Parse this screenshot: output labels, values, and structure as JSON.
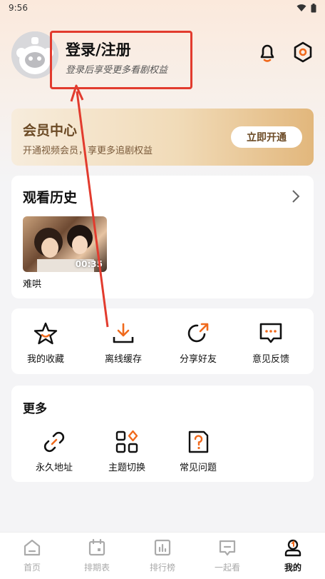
{
  "status_bar": {
    "time": "9:56"
  },
  "profile": {
    "login_title": "登录/注册",
    "login_subtitle": "登录后享受更多看剧权益"
  },
  "vip": {
    "title": "会员中心",
    "subtitle": "开通视频会员，享更多追剧权益",
    "button": "立即开通"
  },
  "history": {
    "title": "观看历史",
    "items": [
      {
        "name": "难哄",
        "duration": "00:35"
      }
    ]
  },
  "tools": [
    {
      "label": "我的收藏",
      "icon": "star-icon"
    },
    {
      "label": "离线缓存",
      "icon": "download-icon"
    },
    {
      "label": "分享好友",
      "icon": "share-icon"
    },
    {
      "label": "意见反馈",
      "icon": "feedback-icon"
    }
  ],
  "more": {
    "title": "更多",
    "items": [
      {
        "label": "永久地址",
        "icon": "link-icon"
      },
      {
        "label": "主题切换",
        "icon": "theme-icon"
      },
      {
        "label": "常见问题",
        "icon": "faq-icon"
      }
    ]
  },
  "tabbar": [
    {
      "label": "首页",
      "icon": "home-icon"
    },
    {
      "label": "排期表",
      "icon": "calendar-icon"
    },
    {
      "label": "排行榜",
      "icon": "ranking-icon"
    },
    {
      "label": "一起看",
      "icon": "watch-together-icon"
    },
    {
      "label": "我的",
      "icon": "profile-icon",
      "active": true
    }
  ],
  "colors": {
    "accent": "#f06a1d",
    "annotation": "#e23b2e",
    "vip_text": "#6b4a25"
  }
}
